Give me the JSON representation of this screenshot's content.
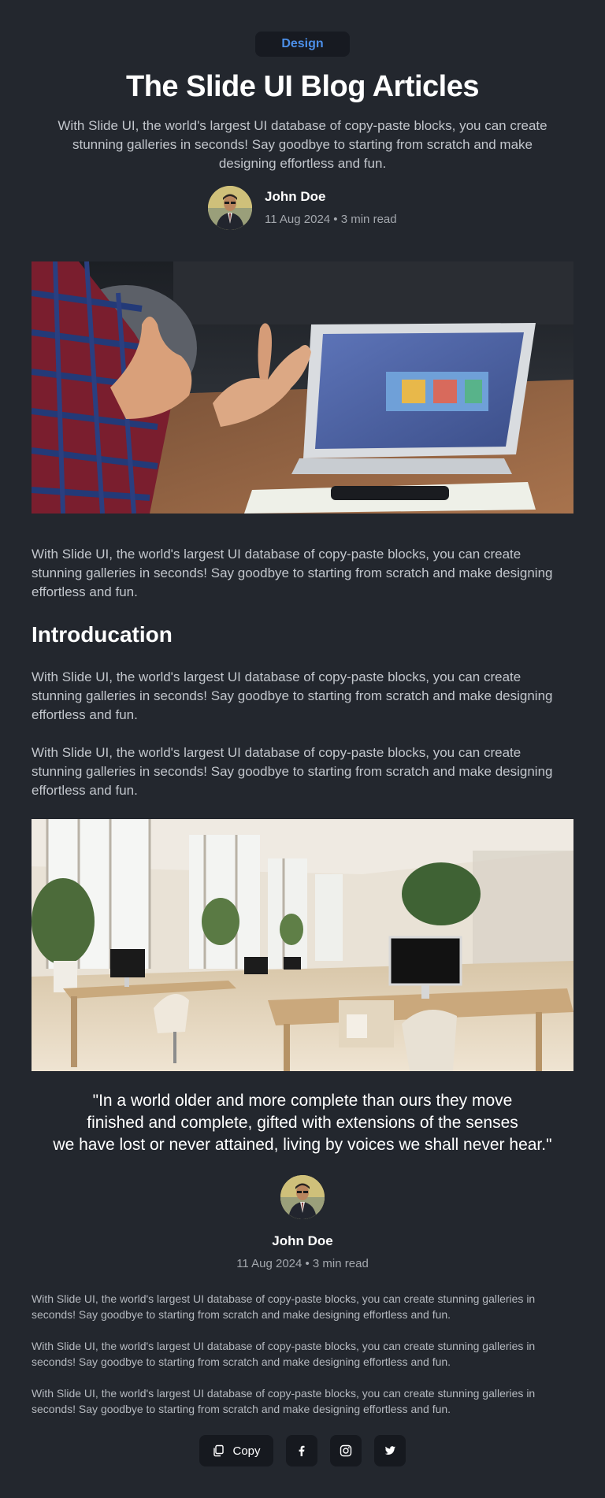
{
  "category": "Design",
  "header": {
    "title": "The Slide UI Blog Articles",
    "lead": "With Slide UI, the world's largest UI database of copy-paste blocks, you can create stunning galleries in seconds! Say goodbye to starting from scratch and make designing effortless and fun."
  },
  "author": {
    "name": "John Doe",
    "meta": "11 Aug 2024 • 3 min read"
  },
  "article": {
    "intro_paragraph": "With Slide UI, the world's largest UI database of copy-paste blocks, you can create stunning galleries in seconds! Say goodbye to starting from scratch and make designing effortless and fun.",
    "section_title": "Introducation",
    "paragraphs": [
      "With Slide UI, the world's largest UI database of copy-paste blocks, you can create stunning galleries in seconds! Say goodbye to starting from scratch and make designing effortless and fun.",
      "With Slide UI, the world's largest UI database of copy-paste blocks, you can create stunning galleries in seconds! Say goodbye to starting from scratch and make designing effortless and fun."
    ],
    "quote_lines": [
      "\"In a world older and more complete than ours they move",
      "finished and complete, gifted with extensions of the senses",
      "we have lost or never attained, living by voices we shall never hear.\""
    ],
    "footer_paragraphs": [
      "With Slide UI, the world's largest UI database of copy-paste blocks, you can create stunning galleries in seconds! Say goodbye to starting from scratch and make designing effortless and fun.",
      "With Slide UI, the world's largest UI database of copy-paste blocks, you can create stunning galleries in seconds! Say goodbye to starting from scratch and make designing effortless and fun.",
      "With Slide UI, the world's largest UI database of copy-paste blocks, you can create stunning galleries in seconds! Say goodbye to starting from scratch and make designing effortless and fun."
    ]
  },
  "share": {
    "copy_label": "Copy",
    "icons": [
      "copy-icon",
      "facebook-icon",
      "instagram-icon",
      "twitter-icon"
    ]
  },
  "colors": {
    "background": "#23272e",
    "accent": "#4c8fe8",
    "button_bg": "#16191f"
  }
}
